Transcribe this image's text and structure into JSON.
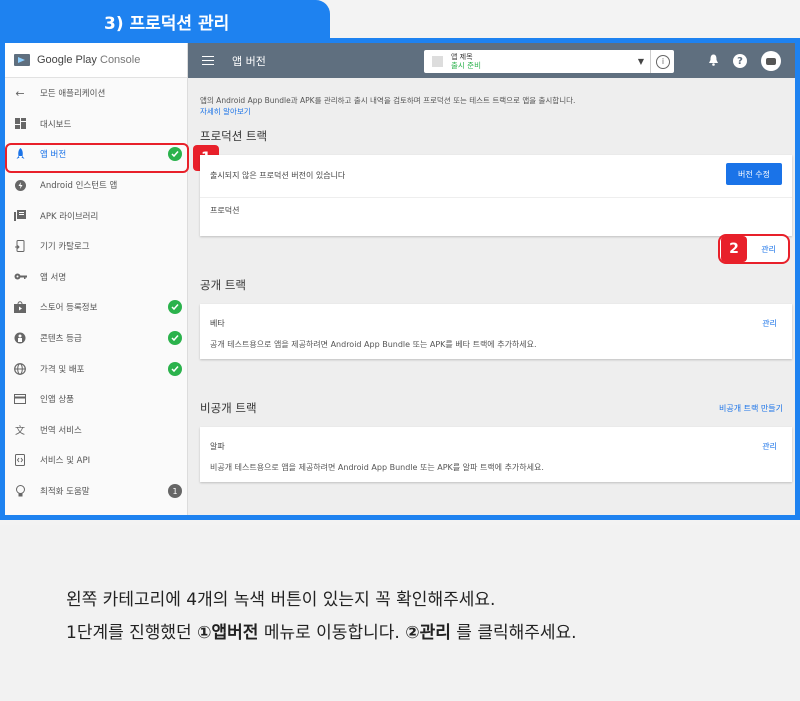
{
  "banner": {
    "title": "3) 프로덕션 관리"
  },
  "sidebar": {
    "logo_text_1": "Google Play",
    "logo_text_2": "Console",
    "items": [
      {
        "label": "모든 애플리케이션",
        "icon": "arrow-left-icon"
      },
      {
        "label": "대시보드",
        "icon": "dashboard-icon"
      },
      {
        "label": "앱 버전",
        "icon": "rocket-icon",
        "active": true,
        "check": true
      },
      {
        "label": "Android 인스턴트 앱",
        "icon": "bolt-icon"
      },
      {
        "label": "APK 라이브러리",
        "icon": "library-icon"
      },
      {
        "label": "기기 카탈로그",
        "icon": "device-icon"
      },
      {
        "label": "앱 서명",
        "icon": "key-icon"
      },
      {
        "label": "스토어 등록정보",
        "icon": "store-icon",
        "check": true
      },
      {
        "label": "콘텐츠 등급",
        "icon": "rating-icon",
        "check": true
      },
      {
        "label": "가격 및 배포",
        "icon": "globe-icon",
        "check": true
      },
      {
        "label": "인앱 상품",
        "icon": "card-icon"
      },
      {
        "label": "번역 서비스",
        "icon": "translate-icon"
      },
      {
        "label": "서비스 및 API",
        "icon": "api-icon"
      },
      {
        "label": "최적화 도움말",
        "icon": "bulb-icon",
        "badge": "1"
      }
    ]
  },
  "annotations": {
    "tag1": "1",
    "tag2": "2"
  },
  "appbar": {
    "title": "앱 버전",
    "app_name": "앱 제목",
    "app_status": "출시 준비",
    "info": "i",
    "help": "?"
  },
  "main": {
    "description": "앱의 Android App Bundle과 APK를 관리하고 출시 내역을 검토하며 프로덕션 또는 테스트 트랙으로 앱을 출시합니다.",
    "learn_more": "자세히 알아보기",
    "production": {
      "section_title": "프로덕션 트랙",
      "notice": "출시되지 않은 프로덕션 버전이 있습니다",
      "edit_button": "버전 수정",
      "track_name": "프로덕션",
      "manage": "관리"
    },
    "open": {
      "section_title": "공개 트랙",
      "track_name": "베타",
      "manage": "관리",
      "desc": "공개 테스트용으로 앱을 제공하려면 Android App Bundle 또는 APK를 베타 트랙에 추가하세요."
    },
    "closed": {
      "section_title": "비공개 트랙",
      "create": "비공개 트랙 만들기",
      "track_name": "알파",
      "manage": "관리",
      "desc": "비공개 테스트용으로 앱을 제공하려면 Android App Bundle 또는 APK를 알파 트랙에 추가하세요."
    }
  },
  "caption": {
    "line1": "왼쪽 카테고리에 4개의 녹색 버튼이 있는지 꼭 확인해주세요.",
    "line2_a": "1단계를 진행했던 ",
    "line2_b": "①앱버전",
    "line2_c": " 메뉴로 이동합니다. ",
    "line2_d": "②관리",
    "line2_e": " 를 클릭해주세요."
  }
}
